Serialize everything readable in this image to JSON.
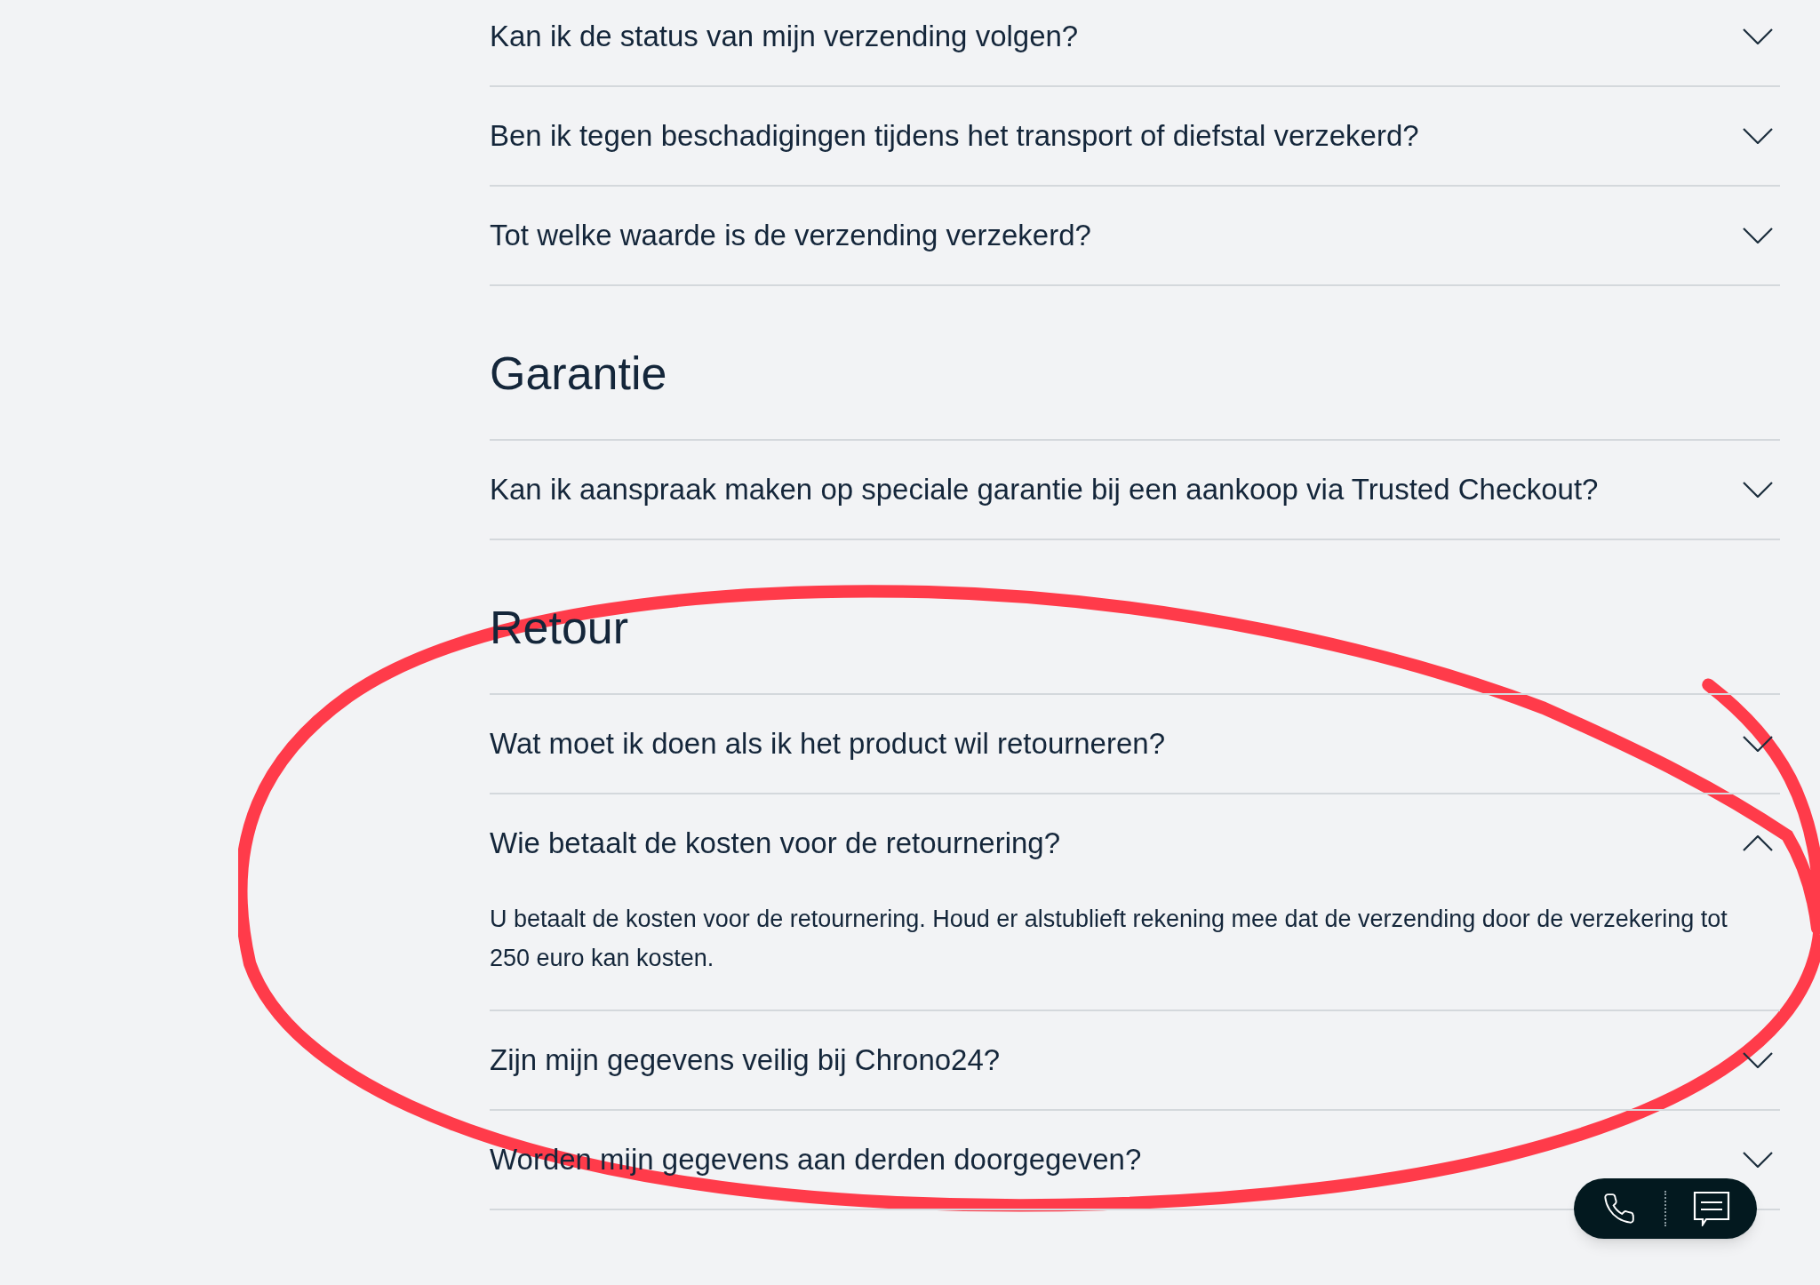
{
  "sections": [
    {
      "items": [
        {
          "question": "Kan ik de status van mijn verzending volgen?",
          "expanded": false
        },
        {
          "question": "Ben ik tegen beschadigingen tijdens het transport of diefstal verzekerd?",
          "expanded": false
        },
        {
          "question": "Tot welke waarde is de verzending verzekerd?",
          "expanded": false
        }
      ]
    },
    {
      "heading": "Garantie",
      "items": [
        {
          "question": "Kan ik aanspraak maken op speciale garantie bij een aankoop via Trusted Checkout?",
          "expanded": false
        }
      ]
    },
    {
      "heading": "Retour",
      "items": [
        {
          "question": "Wat moet ik doen als ik het product wil retourneren?",
          "expanded": false
        },
        {
          "question": "Wie betaalt de kosten voor de retournering?",
          "expanded": true,
          "answer": "U betaalt de kosten voor de retournering. Houd er alstublieft rekening mee dat de verzending door de verzekering tot 250 euro kan kosten."
        },
        {
          "question": "Zijn mijn gegevens veilig bij Chrono24?",
          "expanded": false
        },
        {
          "question": "Worden mijn gegevens aan derden doorgegeven?",
          "expanded": false
        }
      ]
    }
  ]
}
